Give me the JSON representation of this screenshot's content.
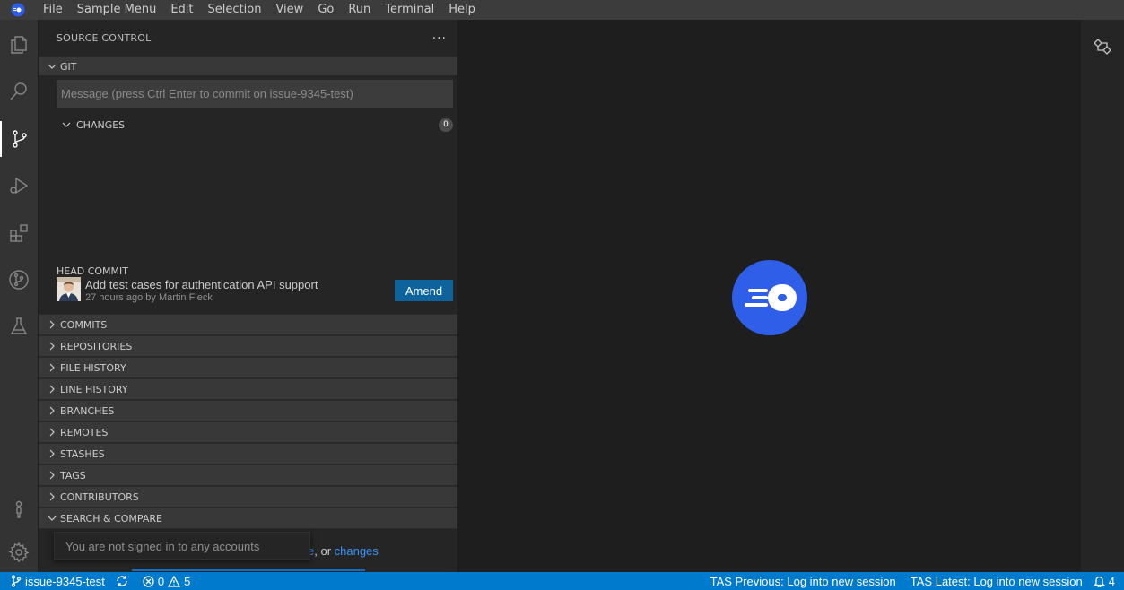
{
  "menubar": {
    "items": [
      "File",
      "Sample Menu",
      "Edit",
      "Selection",
      "View",
      "Go",
      "Run",
      "Terminal",
      "Help"
    ]
  },
  "sidebar": {
    "title": "SOURCE CONTROL",
    "more": "···",
    "git_section": "GIT",
    "commit_placeholder": "Message (press Ctrl Enter to commit on issue-9345-test)",
    "changes_label": "CHANGES",
    "changes_count": "0",
    "head_commit": {
      "label": "HEAD COMMIT",
      "message": "Add test cases for authentication API support",
      "meta": "27 hours ago by Martin Fleck",
      "amend_label": "Amend"
    },
    "sections": [
      "COMMITS",
      "REPOSITORIES",
      "FILE HISTORY",
      "LINE HISTORY",
      "BRANCHES",
      "REMOTES",
      "STASHES",
      "TAGS",
      "CONTRIBUTORS"
    ],
    "search_section": "SEARCH & COMPARE",
    "search_tail_prefix": "e",
    "search_tail_or": ", or ",
    "search_tail_link": "changes",
    "tooltip": "You are not signed in to any accounts"
  },
  "statusbar": {
    "branch": "issue-9345-test",
    "errors": "0",
    "warnings": "5",
    "tas_previous": "TAS Previous: Log into new session",
    "tas_latest": "TAS Latest: Log into new session",
    "notifications": "4"
  },
  "colors": {
    "accent": "#007acc",
    "button": "#0e639c",
    "logo_blue": "#2f5ee8"
  }
}
